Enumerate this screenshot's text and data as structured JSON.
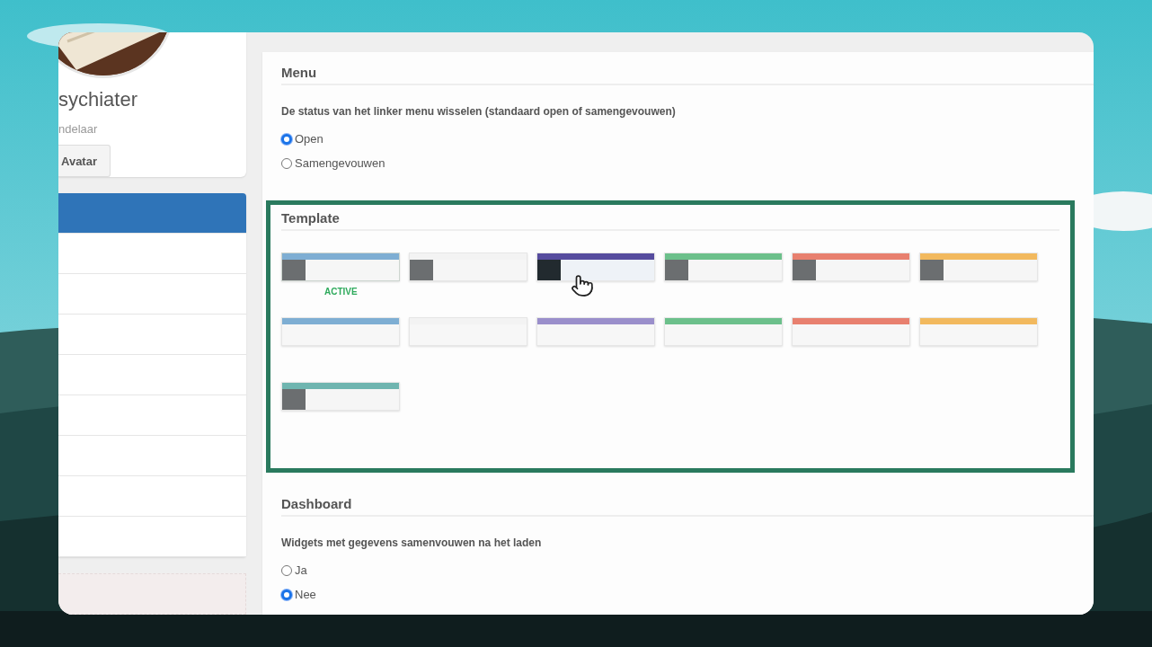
{
  "profile": {
    "name": "sychiater",
    "role": "ndelaar",
    "avatar_button": "Avatar"
  },
  "nav_items": [
    {
      "selected": true
    },
    {
      "selected": false
    },
    {
      "selected": false
    },
    {
      "selected": false
    },
    {
      "selected": false
    },
    {
      "selected": false
    },
    {
      "selected": false
    },
    {
      "selected": false
    },
    {
      "selected": false
    }
  ],
  "menu": {
    "heading": "Menu",
    "question": "De status van het linker menu wisselen (standaard open of samengevouwen)",
    "options": [
      {
        "label": "Open",
        "selected": true
      },
      {
        "label": "Samengevouwen",
        "selected": false
      }
    ]
  },
  "template": {
    "heading": "Template",
    "active_label": "ACTIVE",
    "items": [
      {
        "color": "#7eaed3",
        "kind": "grey",
        "selected": true,
        "hover": false
      },
      {
        "color": "#f3f3f3",
        "kind": "grey",
        "selected": false,
        "hover": false
      },
      {
        "color": "#564c9e",
        "kind": "black",
        "selected": false,
        "hover": true
      },
      {
        "color": "#6cc08b",
        "kind": "grey",
        "selected": false,
        "hover": false
      },
      {
        "color": "#e8806f",
        "kind": "grey",
        "selected": false,
        "hover": false
      },
      {
        "color": "#f2b95e",
        "kind": "grey",
        "selected": false,
        "hover": false
      },
      {
        "color": "#7eaed3",
        "kind": "plain",
        "selected": false,
        "hover": false
      },
      {
        "color": "#f3f3f3",
        "kind": "plain",
        "selected": false,
        "hover": false
      },
      {
        "color": "#9a8fcb",
        "kind": "plain",
        "selected": false,
        "hover": false
      },
      {
        "color": "#6cc08b",
        "kind": "plain",
        "selected": false,
        "hover": false
      },
      {
        "color": "#e8806f",
        "kind": "plain",
        "selected": false,
        "hover": false
      },
      {
        "color": "#f2b95e",
        "kind": "plain",
        "selected": false,
        "hover": false
      },
      {
        "color": "#6fb5b0",
        "kind": "grey",
        "selected": false,
        "hover": false
      }
    ]
  },
  "dashboard": {
    "heading": "Dashboard",
    "question": "Widgets met gegevens samenvouwen na het laden",
    "options": [
      {
        "label": "Ja",
        "selected": false
      },
      {
        "label": "Nee",
        "selected": true
      }
    ]
  }
}
